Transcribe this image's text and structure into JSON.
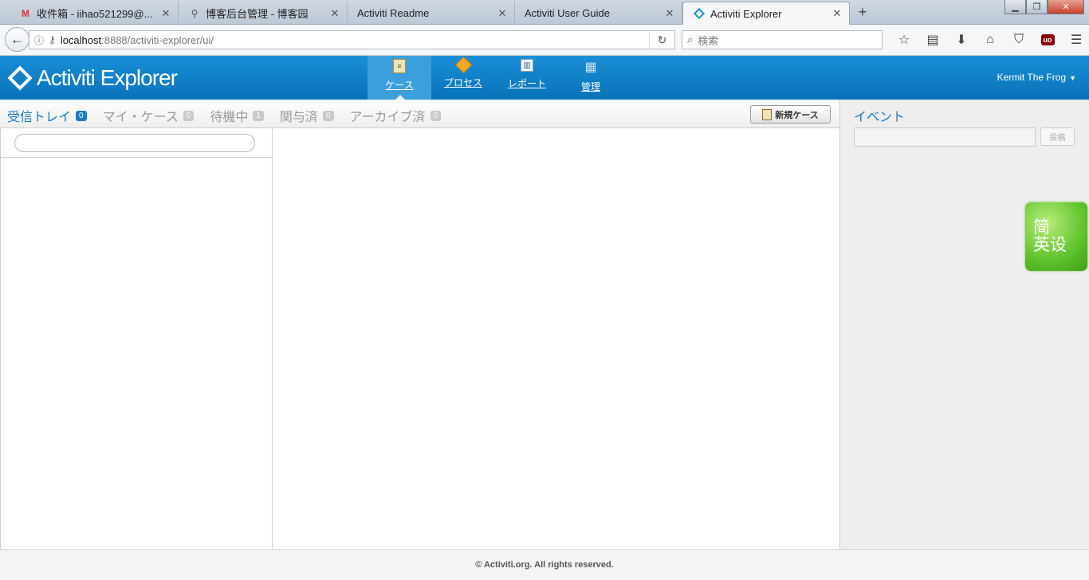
{
  "browser": {
    "tabs": [
      {
        "title": "收件箱 - iihao521299@...",
        "favicon": "gmail-icon"
      },
      {
        "title": "博客后台管理 - 博客园",
        "favicon": "blog-icon"
      },
      {
        "title": "Activiti Readme",
        "favicon": ""
      },
      {
        "title": "Activiti User Guide",
        "favicon": ""
      },
      {
        "title": "Activiti Explorer",
        "favicon": "activiti-icon"
      }
    ],
    "url_host": "localhost",
    "url_path": ":8888/activiti-explorer/ui/",
    "search_placeholder": "検索"
  },
  "app": {
    "logo_text": "Activiti Explorer",
    "nav": [
      {
        "label": "ケース",
        "icon": "clipboard-icon",
        "active": true
      },
      {
        "label": "プロセス",
        "icon": "process-icon",
        "active": false
      },
      {
        "label": "レポート",
        "icon": "report-icon",
        "active": false
      },
      {
        "label": "管理",
        "icon": "admin-icon",
        "active": false
      }
    ],
    "user": "Kermit The Frog"
  },
  "subtabs": [
    {
      "label": "受信トレイ",
      "count": "0",
      "active": true
    },
    {
      "label": "マイ・ケース",
      "count": "0",
      "active": false
    },
    {
      "label": "待機中",
      "count": "1",
      "active": false
    },
    {
      "label": "関与済",
      "count": "0",
      "active": false
    },
    {
      "label": "アーカイブ済",
      "count": "0",
      "active": false
    }
  ],
  "new_case_label": "新規ケース",
  "case_search_value": "",
  "events": {
    "title": "イベント",
    "input_value": "",
    "post_label": "投稿"
  },
  "widget": {
    "line1": "简",
    "line2": "英设"
  },
  "footer": "© Activiti.org. All rights reserved.",
  "colors": {
    "header_blue": "#0a78c2",
    "active_tab_blue": "#1a7cc8",
    "widget_green": "#5ec32c"
  }
}
